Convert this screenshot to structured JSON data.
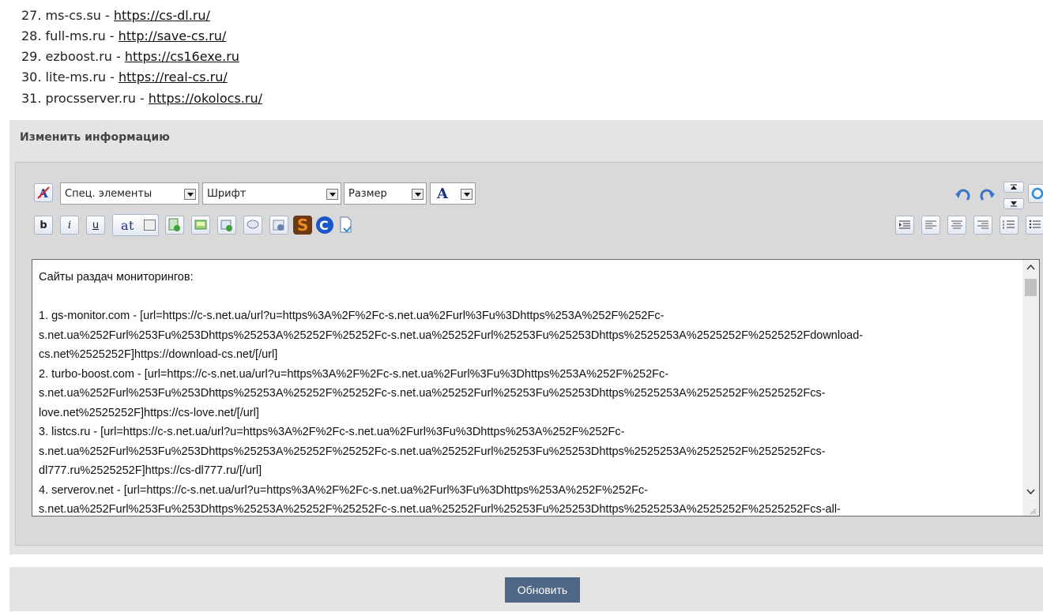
{
  "list": {
    "items": [
      {
        "num": "27.",
        "site": "ms-cs.su",
        "sep": " - ",
        "link": "https://cs-dl.ru/"
      },
      {
        "num": "28.",
        "site": "full-ms.ru",
        "sep": " - ",
        "link": "http://save-cs.ru/"
      },
      {
        "num": "29.",
        "site": "ezboost.ru",
        "sep": " - ",
        "link": "https://cs16exe.ru"
      },
      {
        "num": "30.",
        "site": "lite-ms.ru",
        "sep": " - ",
        "link": "https://real-cs.ru/"
      },
      {
        "num": "31.",
        "site": "procsserver.ru",
        "sep": " - ",
        "link": "https://okolocs.ru/"
      }
    ]
  },
  "panel": {
    "title": "Изменить информацию"
  },
  "toolbar": {
    "special_elements": "Спец. элементы",
    "font": "Шрифт",
    "size": "Размер",
    "color_glyph": "A"
  },
  "editor": {
    "content": "Сайты раздач мониторингов:\n\n1. gs-monitor.com - [url=https://c-s.net.ua/url?u=https%3A%2F%2Fc-s.net.ua%2Furl%3Fu%3Dhttps%253A%252F%252Fc-\ns.net.ua%252Furl%253Fu%253Dhttps%25253A%25252F%25252Fc-s.net.ua%25252Furl%25253Fu%25253Dhttps%2525253A%2525252F%2525252Fdownload-\ncs.net%2525252F]https://download-cs.net/[/url]\n2. turbo-boost.com - [url=https://c-s.net.ua/url?u=https%3A%2F%2Fc-s.net.ua%2Furl%3Fu%3Dhttps%253A%252F%252Fc-\ns.net.ua%252Furl%253Fu%253Dhttps%25253A%25252F%25252Fc-s.net.ua%25252Furl%25253Fu%25253Dhttps%2525253A%2525252F%2525252Fcs-\nlove.net%2525252F]https://cs-love.net/[/url]\n3. listcs.ru - [url=https://c-s.net.ua/url?u=https%3A%2F%2Fc-s.net.ua%2Furl%3Fu%3Dhttps%253A%252F%252Fc-\ns.net.ua%252Furl%253Fu%253Dhttps%25253A%25252F%25252Fc-s.net.ua%25252Furl%25253Fu%25253Dhttps%2525253A%2525252F%2525252Fcs-\ndl777.ru%2525252F]https://cs-dl777.ru/[/url]\n4. serverov.net - [url=https://c-s.net.ua/url?u=https%3A%2F%2Fc-s.net.ua%2Furl%3Fu%3Dhttps%253A%252F%252Fc-\ns.net.ua%252Furl%253Fu%253Dhttps%25253A%25252F%25252Fc-s.net.ua%25252Furl%25253Fu%25253Dhttps%2525253A%2525252F%2525252Fcs-all-"
  },
  "footer": {
    "update_label": "Обновить"
  }
}
